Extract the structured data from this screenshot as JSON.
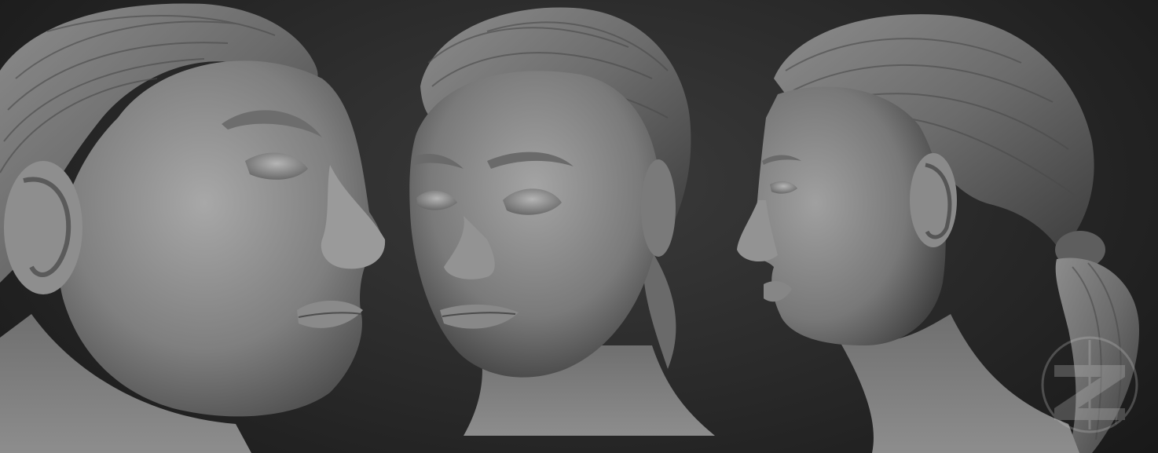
{
  "scene": {
    "background_color": "#222222",
    "clay_color": "#8a8a8a",
    "views": [
      "three-quarter-low-view",
      "front-three-quarter-view",
      "left-profile-view"
    ]
  },
  "watermark": {
    "icon": "zbrush-logo-icon"
  }
}
